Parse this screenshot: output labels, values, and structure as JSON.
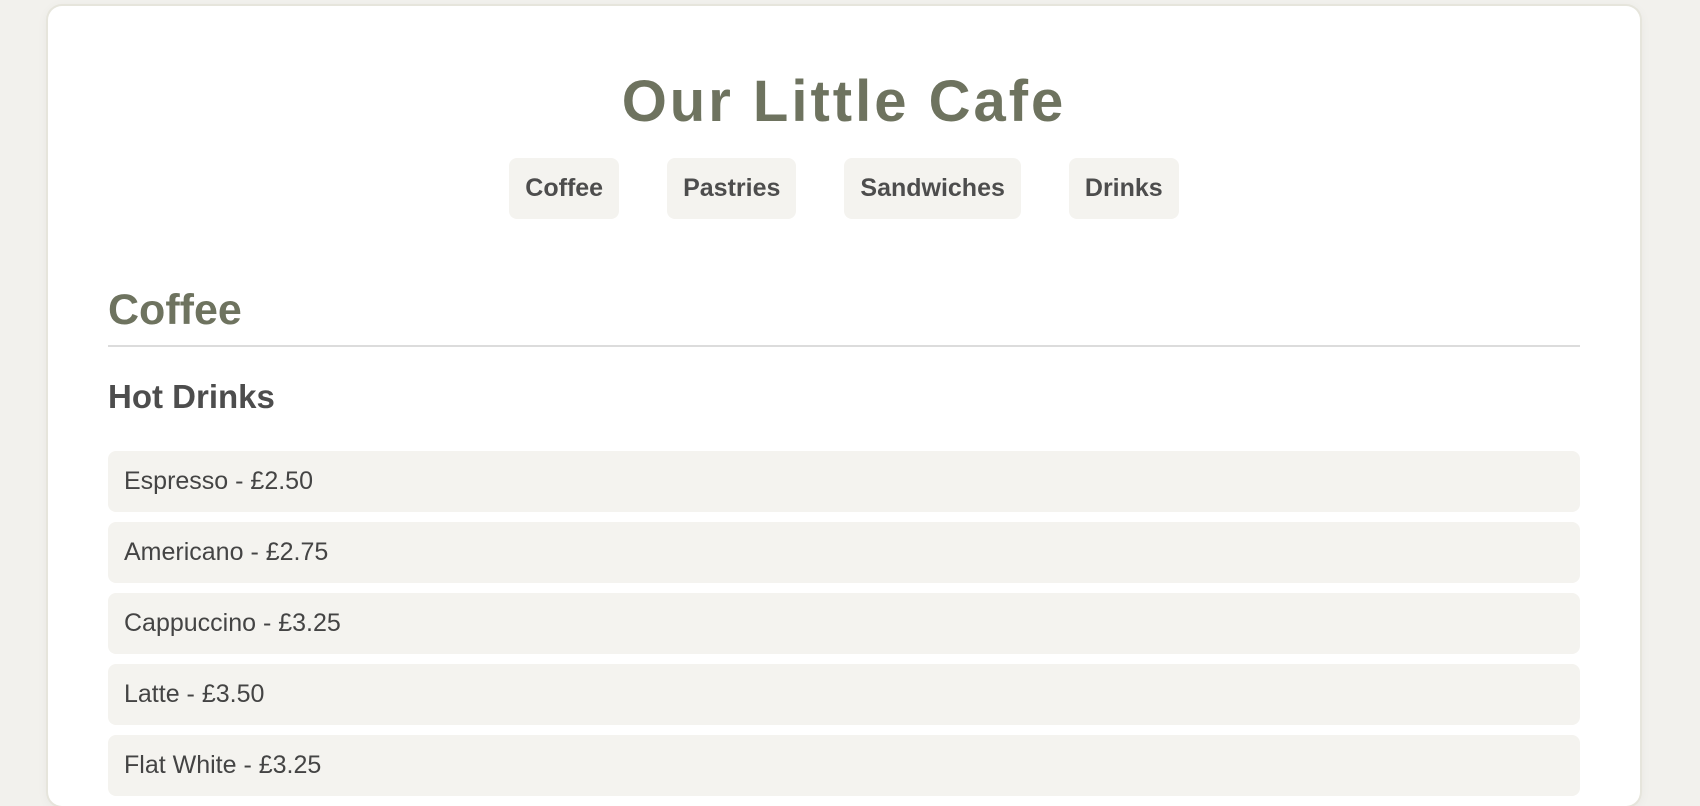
{
  "header": {
    "title": "Our Little Cafe"
  },
  "nav": {
    "items": [
      {
        "label": "Coffee"
      },
      {
        "label": "Pastries"
      },
      {
        "label": "Sandwiches"
      },
      {
        "label": "Drinks"
      }
    ]
  },
  "section": {
    "title": "Coffee",
    "subsection": {
      "title": "Hot Drinks",
      "items": [
        {
          "label": "Espresso - £2.50"
        },
        {
          "label": "Americano - £2.75"
        },
        {
          "label": "Cappuccino - £3.25"
        },
        {
          "label": "Latte - £3.50"
        },
        {
          "label": "Flat White - £3.25"
        }
      ]
    }
  },
  "colors": {
    "accent": "#6e735f",
    "page_background": "#f2f1ed",
    "item_background": "#f4f3ef",
    "text": "#4d4d4d"
  }
}
